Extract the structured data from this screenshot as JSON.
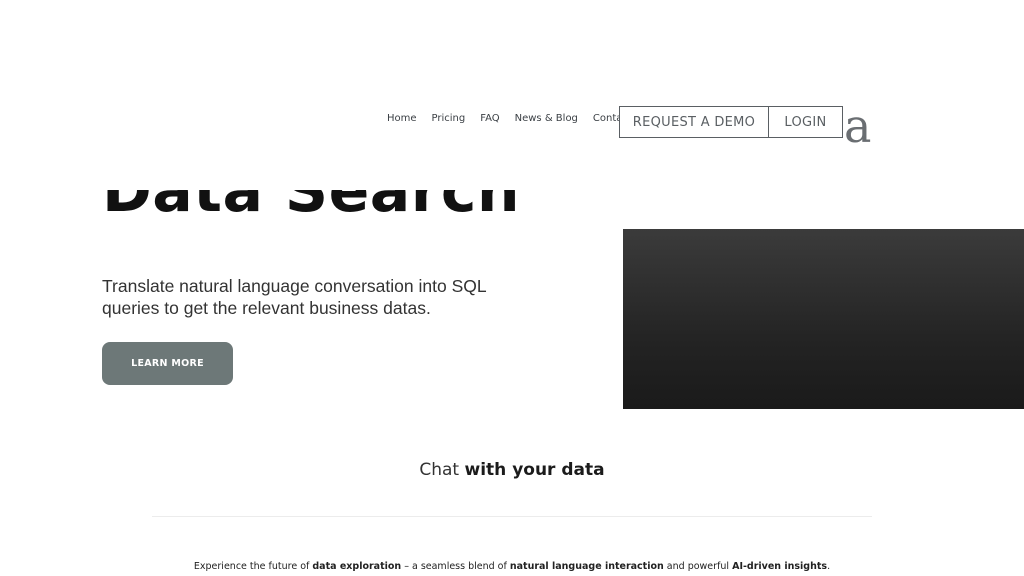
{
  "nav": {
    "links": [
      "Home",
      "Pricing",
      "FAQ",
      "News & Blog",
      "Contact"
    ],
    "request_demo": "REQUEST A DEMO",
    "login": "LOGIN",
    "logo_letter": "a"
  },
  "hero": {
    "title": "Data Search",
    "subtitle": "Translate natural language conversation into SQL queries to get the relevant business datas.",
    "cta": "LEARN MORE"
  },
  "section": {
    "title_part1": "Chat",
    "title_part2": "with your data",
    "tagline": {
      "t1": "Experience the future of ",
      "b1": "data exploration",
      "t2": " – a seamless blend of ",
      "b2": "natural language interaction",
      "t3": " and powerful ",
      "b3": "AI-driven insights",
      "t4": "."
    }
  },
  "colors": {
    "cta_bg": "#6d7878",
    "outline": "#5a5f63",
    "media_dark": "#242424"
  }
}
